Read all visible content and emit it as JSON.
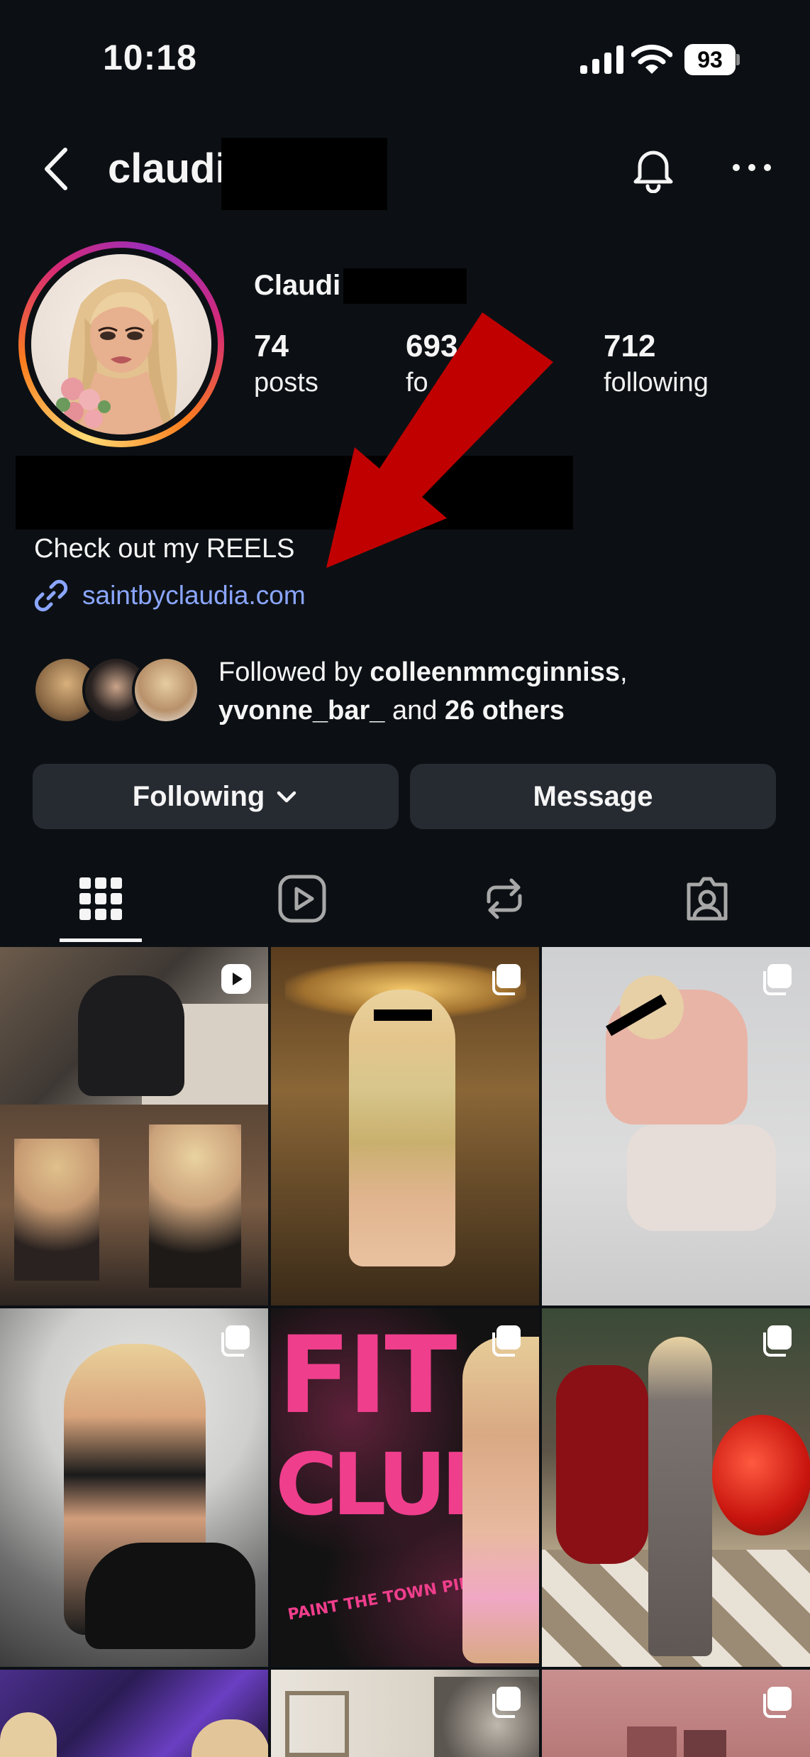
{
  "status_bar": {
    "time": "10:18",
    "battery": "93"
  },
  "header": {
    "username": "claudi",
    "icons": [
      "back-arrow-icon",
      "bell-icon",
      "more-icon"
    ]
  },
  "profile": {
    "display_name": "Claudi",
    "stats": [
      {
        "num": "74",
        "label": "posts"
      },
      {
        "num": "693",
        "label": "fo"
      },
      {
        "num": "712",
        "label": "following"
      }
    ],
    "bio": "Check out my REELS",
    "link": "saintbyclaudia.com"
  },
  "followed_by": {
    "prefix": "Followed by ",
    "user1": "colleenmmcginniss",
    "sep": ",",
    "user2": "yvonne_bar_",
    "mid": " and ",
    "others": "26 others"
  },
  "buttons": {
    "following": "Following",
    "message": "Message"
  },
  "tabs": [
    "grid-icon",
    "reels-icon",
    "reposts-icon",
    "tagged-icon"
  ],
  "grid_badges": [
    "reel-icon",
    "carousel-icon",
    "carousel-icon",
    "carousel-icon",
    "carousel-icon",
    "carousel-icon",
    "",
    "",
    "carousel-icon"
  ],
  "grid_text": {
    "fit": "FIT",
    "club": "CLUB",
    "paint": "PAINT THE TOWN PINK"
  },
  "colors": {
    "background": "#0c1014",
    "button": "#262a31",
    "link": "#8ba6ff",
    "arrow": "#c00000"
  }
}
